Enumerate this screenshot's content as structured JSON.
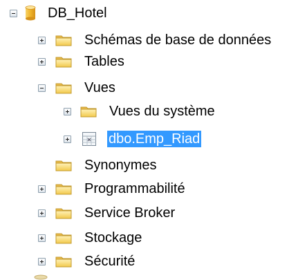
{
  "tree": {
    "root": {
      "label": "DB_Hotel",
      "icon": "database-icon",
      "expanded": true
    },
    "items": [
      {
        "label": "Schémas de base de données",
        "icon": "folder-icon",
        "expanded": false
      },
      {
        "label": "Tables",
        "icon": "folder-icon",
        "expanded": false
      },
      {
        "label": "Vues",
        "icon": "folder-icon",
        "expanded": true,
        "children": [
          {
            "label": "Vues du système",
            "icon": "folder-icon",
            "expanded": false
          },
          {
            "label": "dbo.Emp_Riad",
            "icon": "view-icon",
            "expanded": false,
            "selected": true
          }
        ]
      },
      {
        "label": "Synonymes",
        "icon": "folder-icon"
      },
      {
        "label": "Programmabilité",
        "icon": "folder-icon",
        "expanded": false
      },
      {
        "label": "Service Broker",
        "icon": "folder-icon",
        "expanded": false
      },
      {
        "label": "Stockage",
        "icon": "folder-icon",
        "expanded": false
      },
      {
        "label": "Sécurité",
        "icon": "folder-icon",
        "expanded": false
      }
    ]
  },
  "colors": {
    "selection": "#3399ff",
    "folder": "#f2c94c",
    "database": "#f0b429"
  }
}
